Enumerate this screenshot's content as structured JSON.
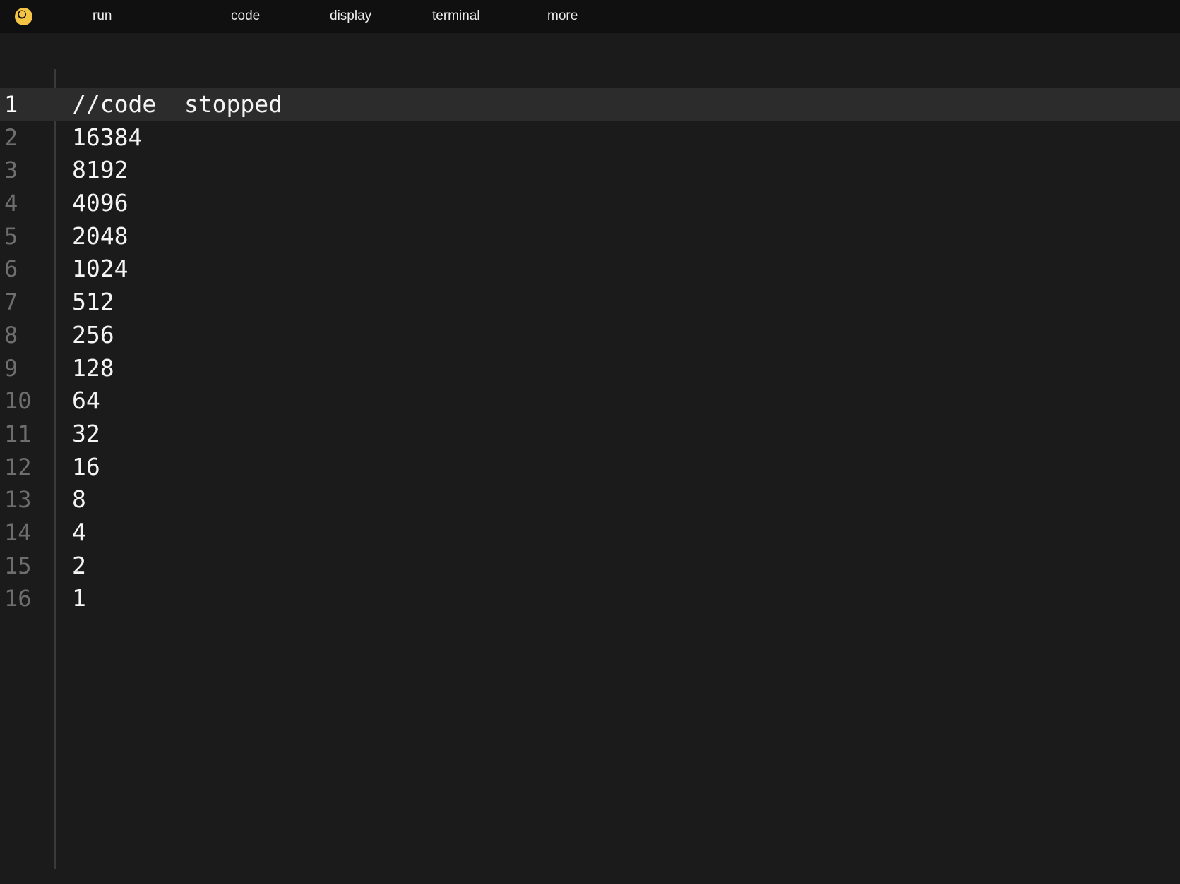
{
  "menu": {
    "items": [
      "run",
      "code",
      "display",
      "terminal",
      "more"
    ]
  },
  "colors": {
    "logo": "#f6c445",
    "topbar_bg": "#101010",
    "editor_bg": "#1b1b1b",
    "active_line_bg": "#2c2c2c"
  },
  "icons": {
    "logo": "app-logo-icon"
  },
  "editor": {
    "active_line": 1,
    "lines": [
      {
        "number": "1",
        "text": "//code  stopped"
      },
      {
        "number": "2",
        "text": "16384"
      },
      {
        "number": "3",
        "text": "8192"
      },
      {
        "number": "4",
        "text": "4096"
      },
      {
        "number": "5",
        "text": "2048"
      },
      {
        "number": "6",
        "text": "1024"
      },
      {
        "number": "7",
        "text": "512"
      },
      {
        "number": "8",
        "text": "256"
      },
      {
        "number": "9",
        "text": "128"
      },
      {
        "number": "10",
        "text": "64"
      },
      {
        "number": "11",
        "text": "32"
      },
      {
        "number": "12",
        "text": "16"
      },
      {
        "number": "13",
        "text": "8"
      },
      {
        "number": "14",
        "text": "4"
      },
      {
        "number": "15",
        "text": "2"
      },
      {
        "number": "16",
        "text": "1"
      }
    ]
  }
}
